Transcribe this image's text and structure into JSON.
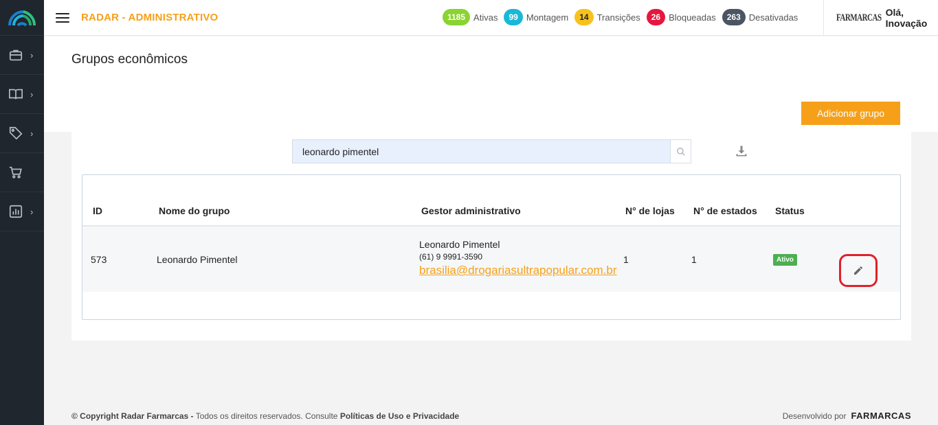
{
  "app": {
    "title": "RADAR - ADMINISTRATIVO"
  },
  "stats": [
    {
      "count": "1185",
      "label": "Ativas",
      "color": "#8bd331"
    },
    {
      "count": "99",
      "label": "Montagem",
      "color": "#1bb8d6"
    },
    {
      "count": "14",
      "label": "Transições",
      "color": "#f8c21e"
    },
    {
      "count": "26",
      "label": "Bloqueadas",
      "color": "#e5173f"
    },
    {
      "count": "263",
      "label": "Desativadas",
      "color": "#4b5563"
    }
  ],
  "user": {
    "logo": "FARMARCAS",
    "greeting": "Olá, Inovação"
  },
  "page": {
    "title": "Grupos econômicos",
    "add_button": "Adicionar grupo"
  },
  "search": {
    "value": "leonardo pimentel"
  },
  "table": {
    "headers": {
      "id": "ID",
      "name": "Nome do grupo",
      "manager": "Gestor administrativo",
      "stores": "N° de lojas",
      "states": "N° de estados",
      "status": "Status"
    },
    "rows": [
      {
        "id": "573",
        "name": "Leonardo Pimentel",
        "manager_name": "Leonardo Pimentel",
        "manager_phone": "(61) 9 9991-3590",
        "manager_email": "brasilia@drogariasultrapopular.com.br",
        "stores": "1",
        "states": "1",
        "status": "Ativo"
      }
    ]
  },
  "footer": {
    "copyright": "© Copyright Radar Farmarcas -",
    "rights": "Todos os direitos reservados. Consulte",
    "policies": "Políticas de Uso e Privacidade",
    "developed_by": "Desenvolvido por",
    "dev_logo": "FARMARCAS"
  },
  "colors": {
    "accent": "#f6a01a",
    "sidebar": "#20262d",
    "status_active": "#4caf50",
    "highlight": "#e0202a"
  }
}
